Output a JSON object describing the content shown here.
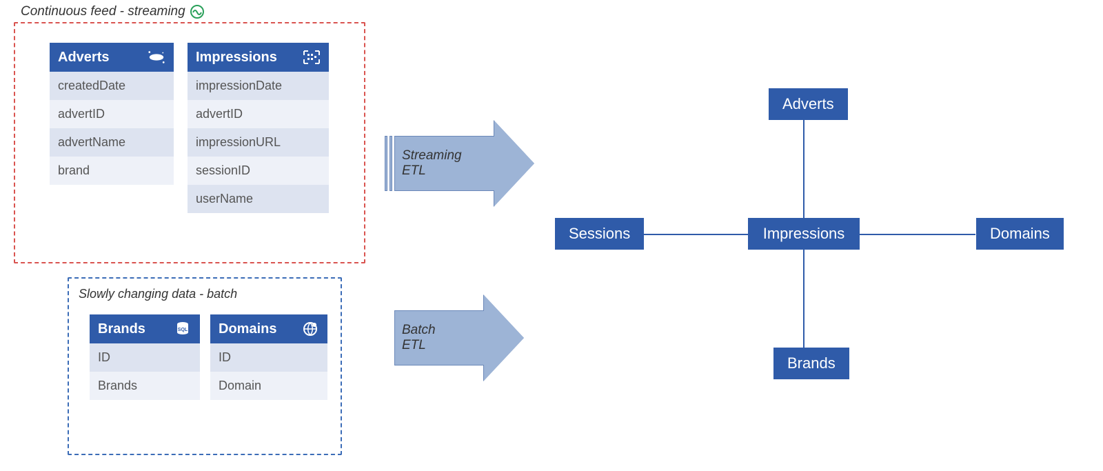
{
  "streaming": {
    "label": "Continuous feed - streaming",
    "tables": [
      {
        "name": "Adverts",
        "icon": "cosmos-db-icon",
        "fields": [
          "createdDate",
          "advertID",
          "advertName",
          "brand"
        ]
      },
      {
        "name": "Impressions",
        "icon": "event-hub-icon",
        "fields": [
          "impressionDate",
          "advertID",
          "impressionURL",
          "sessionID",
          "userName"
        ]
      }
    ]
  },
  "batch": {
    "label": "Slowly changing data - batch",
    "tables": [
      {
        "name": "Brands",
        "icon": "sql-db-icon",
        "fields": [
          "ID",
          "Brands"
        ]
      },
      {
        "name": "Domains",
        "icon": "globe-icon",
        "fields": [
          "ID",
          "Domain"
        ]
      }
    ]
  },
  "arrows": {
    "streaming_line1": "Streaming",
    "streaming_line2": "ETL",
    "batch_line1": "Batch",
    "batch_line2": "ETL"
  },
  "star": {
    "center": "Impressions",
    "top": "Adverts",
    "left": "Sessions",
    "right": "Domains",
    "bottom": "Brands"
  }
}
